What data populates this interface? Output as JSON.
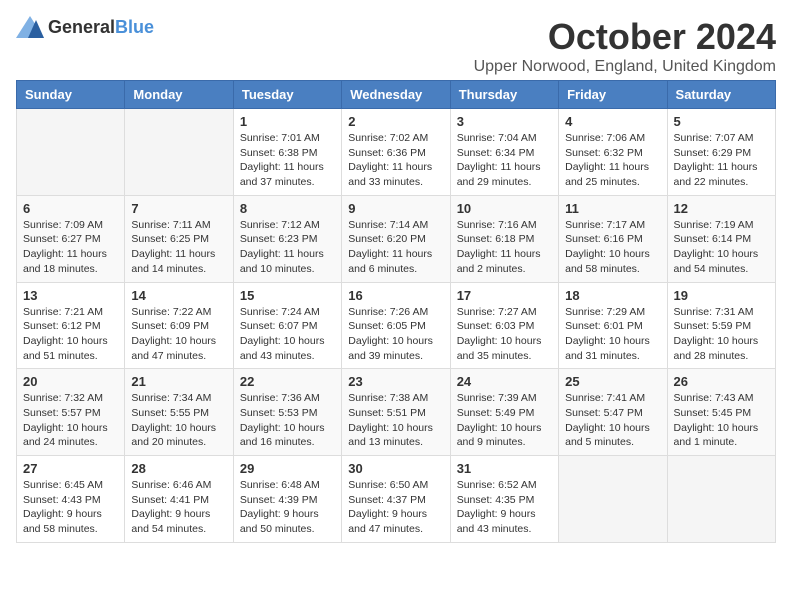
{
  "logo": {
    "general": "General",
    "blue": "Blue"
  },
  "header": {
    "month": "October 2024",
    "location": "Upper Norwood, England, United Kingdom"
  },
  "weekdays": [
    "Sunday",
    "Monday",
    "Tuesday",
    "Wednesday",
    "Thursday",
    "Friday",
    "Saturday"
  ],
  "weeks": [
    [
      {
        "day": "",
        "info": ""
      },
      {
        "day": "",
        "info": ""
      },
      {
        "day": "1",
        "info": "Sunrise: 7:01 AM\nSunset: 6:38 PM\nDaylight: 11 hours and 37 minutes."
      },
      {
        "day": "2",
        "info": "Sunrise: 7:02 AM\nSunset: 6:36 PM\nDaylight: 11 hours and 33 minutes."
      },
      {
        "day": "3",
        "info": "Sunrise: 7:04 AM\nSunset: 6:34 PM\nDaylight: 11 hours and 29 minutes."
      },
      {
        "day": "4",
        "info": "Sunrise: 7:06 AM\nSunset: 6:32 PM\nDaylight: 11 hours and 25 minutes."
      },
      {
        "day": "5",
        "info": "Sunrise: 7:07 AM\nSunset: 6:29 PM\nDaylight: 11 hours and 22 minutes."
      }
    ],
    [
      {
        "day": "6",
        "info": "Sunrise: 7:09 AM\nSunset: 6:27 PM\nDaylight: 11 hours and 18 minutes."
      },
      {
        "day": "7",
        "info": "Sunrise: 7:11 AM\nSunset: 6:25 PM\nDaylight: 11 hours and 14 minutes."
      },
      {
        "day": "8",
        "info": "Sunrise: 7:12 AM\nSunset: 6:23 PM\nDaylight: 11 hours and 10 minutes."
      },
      {
        "day": "9",
        "info": "Sunrise: 7:14 AM\nSunset: 6:20 PM\nDaylight: 11 hours and 6 minutes."
      },
      {
        "day": "10",
        "info": "Sunrise: 7:16 AM\nSunset: 6:18 PM\nDaylight: 11 hours and 2 minutes."
      },
      {
        "day": "11",
        "info": "Sunrise: 7:17 AM\nSunset: 6:16 PM\nDaylight: 10 hours and 58 minutes."
      },
      {
        "day": "12",
        "info": "Sunrise: 7:19 AM\nSunset: 6:14 PM\nDaylight: 10 hours and 54 minutes."
      }
    ],
    [
      {
        "day": "13",
        "info": "Sunrise: 7:21 AM\nSunset: 6:12 PM\nDaylight: 10 hours and 51 minutes."
      },
      {
        "day": "14",
        "info": "Sunrise: 7:22 AM\nSunset: 6:09 PM\nDaylight: 10 hours and 47 minutes."
      },
      {
        "day": "15",
        "info": "Sunrise: 7:24 AM\nSunset: 6:07 PM\nDaylight: 10 hours and 43 minutes."
      },
      {
        "day": "16",
        "info": "Sunrise: 7:26 AM\nSunset: 6:05 PM\nDaylight: 10 hours and 39 minutes."
      },
      {
        "day": "17",
        "info": "Sunrise: 7:27 AM\nSunset: 6:03 PM\nDaylight: 10 hours and 35 minutes."
      },
      {
        "day": "18",
        "info": "Sunrise: 7:29 AM\nSunset: 6:01 PM\nDaylight: 10 hours and 31 minutes."
      },
      {
        "day": "19",
        "info": "Sunrise: 7:31 AM\nSunset: 5:59 PM\nDaylight: 10 hours and 28 minutes."
      }
    ],
    [
      {
        "day": "20",
        "info": "Sunrise: 7:32 AM\nSunset: 5:57 PM\nDaylight: 10 hours and 24 minutes."
      },
      {
        "day": "21",
        "info": "Sunrise: 7:34 AM\nSunset: 5:55 PM\nDaylight: 10 hours and 20 minutes."
      },
      {
        "day": "22",
        "info": "Sunrise: 7:36 AM\nSunset: 5:53 PM\nDaylight: 10 hours and 16 minutes."
      },
      {
        "day": "23",
        "info": "Sunrise: 7:38 AM\nSunset: 5:51 PM\nDaylight: 10 hours and 13 minutes."
      },
      {
        "day": "24",
        "info": "Sunrise: 7:39 AM\nSunset: 5:49 PM\nDaylight: 10 hours and 9 minutes."
      },
      {
        "day": "25",
        "info": "Sunrise: 7:41 AM\nSunset: 5:47 PM\nDaylight: 10 hours and 5 minutes."
      },
      {
        "day": "26",
        "info": "Sunrise: 7:43 AM\nSunset: 5:45 PM\nDaylight: 10 hours and 1 minute."
      }
    ],
    [
      {
        "day": "27",
        "info": "Sunrise: 6:45 AM\nSunset: 4:43 PM\nDaylight: 9 hours and 58 minutes."
      },
      {
        "day": "28",
        "info": "Sunrise: 6:46 AM\nSunset: 4:41 PM\nDaylight: 9 hours and 54 minutes."
      },
      {
        "day": "29",
        "info": "Sunrise: 6:48 AM\nSunset: 4:39 PM\nDaylight: 9 hours and 50 minutes."
      },
      {
        "day": "30",
        "info": "Sunrise: 6:50 AM\nSunset: 4:37 PM\nDaylight: 9 hours and 47 minutes."
      },
      {
        "day": "31",
        "info": "Sunrise: 6:52 AM\nSunset: 4:35 PM\nDaylight: 9 hours and 43 minutes."
      },
      {
        "day": "",
        "info": ""
      },
      {
        "day": "",
        "info": ""
      }
    ]
  ]
}
